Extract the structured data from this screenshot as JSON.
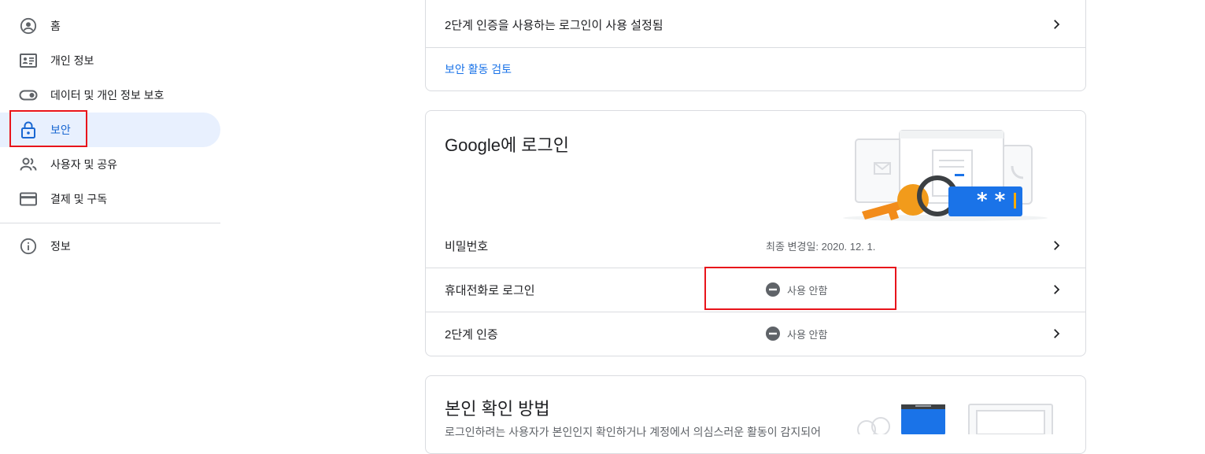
{
  "sidebar": {
    "items": [
      {
        "label": "홈",
        "icon": "account-circle-icon"
      },
      {
        "label": "개인 정보",
        "icon": "id-card-icon"
      },
      {
        "label": "데이터 및 개인 정보 보호",
        "icon": "toggle-icon"
      },
      {
        "label": "보안",
        "icon": "lock-icon",
        "active": true
      },
      {
        "label": "사용자 및 공유",
        "icon": "people-icon"
      },
      {
        "label": "결제 및 구독",
        "icon": "credit-card-icon"
      },
      {
        "label": "정보",
        "icon": "info-icon"
      }
    ]
  },
  "top_card": {
    "row_label": "2단계 인증을 사용하는 로그인이 사용 설정됨",
    "link": "보안 활동 검토"
  },
  "google_signin": {
    "title": "Google에 로그인",
    "rows": [
      {
        "label": "비밀번호",
        "value": "최종 변경일: 2020. 12. 1."
      },
      {
        "label": "휴대전화로 로그인",
        "value": "사용 안함"
      },
      {
        "label": "2단계 인증",
        "value": "사용 안함"
      }
    ]
  },
  "verify": {
    "title": "본인 확인 방법",
    "description": "로그인하려는 사용자가 본인인지 확인하거나 계정에서 의심스러운 활동이 감지되어"
  },
  "colors": {
    "accent": "#1a73e8",
    "active_bg": "#e8f0fe",
    "highlight_box": "#e8141b"
  }
}
